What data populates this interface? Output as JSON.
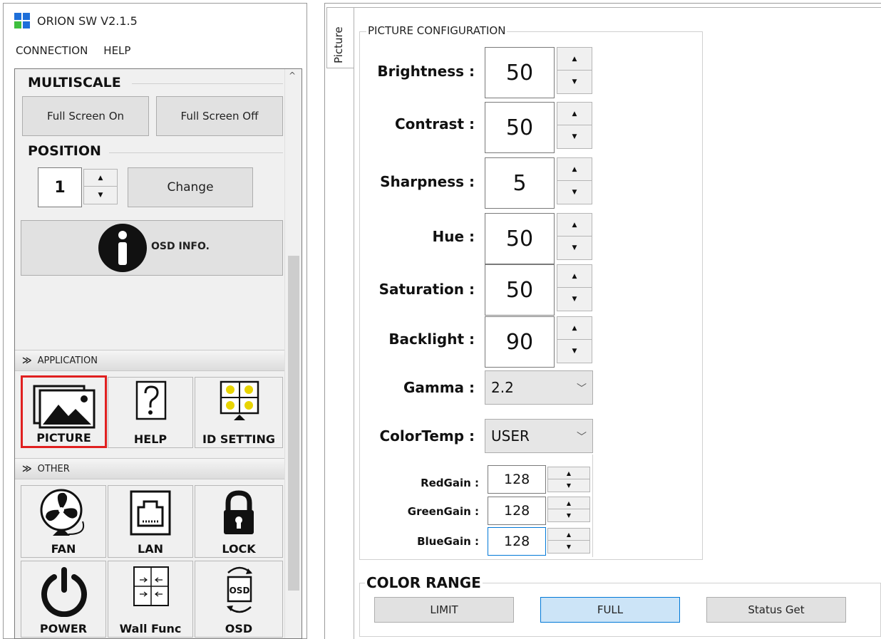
{
  "app": {
    "title": "ORION SW V2.1.5",
    "menu": [
      "CONNECTION",
      "HELP"
    ]
  },
  "left": {
    "multiscale": {
      "heading": "MULTISCALE",
      "on_label": "Full Screen On",
      "off_label": "Full Screen Off"
    },
    "position": {
      "heading": "POSITION",
      "value": "1",
      "change_label": "Change"
    },
    "osd_info": {
      "label": "OSD INFO."
    },
    "application": {
      "heading": "APPLICATION",
      "items": [
        "PICTURE",
        "HELP",
        "ID SETTING"
      ]
    },
    "other": {
      "heading": "OTHER",
      "items": [
        "FAN",
        "LAN",
        "LOCK",
        "POWER",
        "Wall Func",
        "OSD"
      ]
    }
  },
  "right": {
    "tab_label": "Picture",
    "picture_config": {
      "title": "PICTURE CONFIGURATION",
      "params": [
        {
          "label": "Brightness :",
          "value": "50"
        },
        {
          "label": "Contrast :",
          "value": "50"
        },
        {
          "label": "Sharpness :",
          "value": "5"
        },
        {
          "label": "Hue :",
          "value": "50"
        },
        {
          "label": "Saturation :",
          "value": "50"
        },
        {
          "label": "Backlight :",
          "value": "90"
        }
      ],
      "gamma": {
        "label": "Gamma :",
        "value": "2.2"
      },
      "colortemp": {
        "label": "ColorTemp :",
        "value": "USER"
      },
      "gains": [
        {
          "label": "RedGain :",
          "value": "128"
        },
        {
          "label": "GreenGain :",
          "value": "128"
        },
        {
          "label": "BlueGain :",
          "value": "128"
        }
      ]
    },
    "color_range": {
      "title": "COLOR RANGE",
      "limit": "LIMIT",
      "full": "FULL",
      "status": "Status Get"
    }
  },
  "colors": {
    "selection_red": "#e02020",
    "active_blue": "#cce4f7",
    "logo_blue": "#1e6fd9",
    "logo_green": "#3fbf3f"
  }
}
